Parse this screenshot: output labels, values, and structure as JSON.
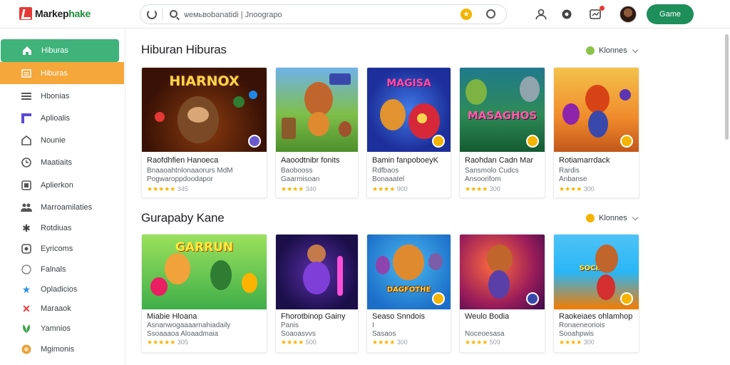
{
  "app": {
    "logo_part1": "Markep",
    "logo_part2": "hake"
  },
  "search": {
    "value": "ѡемьвоbanatidi | Jnoograpo"
  },
  "header": {
    "game_button": "Game"
  },
  "sidebar": {
    "items": [
      {
        "label": "Hiburas",
        "icon": "home-icon"
      },
      {
        "label": "Hiburas",
        "icon": "list-icon"
      },
      {
        "label": "Hbonias",
        "icon": "menu-icon"
      },
      {
        "label": "Aplioalis",
        "icon": "app-icon"
      },
      {
        "label": "Nounie",
        "icon": "house-icon"
      },
      {
        "label": "Maatiaits",
        "icon": "clock-icon"
      },
      {
        "label": "Aplierkon",
        "icon": "square-icon"
      },
      {
        "label": "Marroamilaties",
        "icon": "people-icon"
      },
      {
        "label": "Rotdiuas",
        "icon": "star-icon"
      },
      {
        "label": "Eyricoms",
        "icon": "gear-icon"
      },
      {
        "label": "Falnals",
        "icon": "circle-icon"
      },
      {
        "label": "Opladicios",
        "icon": "badge-icon"
      },
      {
        "label": "Maraaok",
        "icon": "cross-icon"
      },
      {
        "label": "Yamnios",
        "icon": "leaf-icon"
      },
      {
        "label": "Mgimonis",
        "icon": "coin-icon"
      }
    ]
  },
  "sections": [
    {
      "title": "Hiburan Hiburas",
      "sort": "Klonnes",
      "cards": [
        {
          "name": "Raofdhfien Hanoeca",
          "desc1": "Bnaaoahtnlonaaorurs MdM",
          "desc2": "Pogwaroppdoodapor",
          "rating": "★★★★★",
          "num": "345",
          "art": "HIARNOX"
        },
        {
          "name": "Aaoodtnibr fonits",
          "desc1": "Baobooss",
          "desc2": "Gaarmisoan",
          "rating": "★★★★",
          "num": "340",
          "art": ""
        },
        {
          "name": "Bamin fanpoboeyK",
          "desc1": "Rdfbaos",
          "desc2": "Bonaaatel",
          "rating": "★★★★",
          "num": "900",
          "art": "MAGISA"
        },
        {
          "name": "Raohdan Cadn Mar",
          "desc1": "Sansmolo Cudcs",
          "desc2": "Ansoorifom",
          "rating": "★★★★",
          "num": "300",
          "art": "MASAGHOS"
        },
        {
          "name": "Rotiamarrdack",
          "desc1": "Rardis",
          "desc2": "Anbanse",
          "rating": "★★★★",
          "num": "300",
          "art": ""
        }
      ]
    },
    {
      "title": "Gurapaby Kane",
      "sort": "Klonnes",
      "cards": [
        {
          "name": "Miabie Hloana",
          "desc1": "Asnanwogaaaarnahiadaily",
          "desc2": "Ssoaaaoa Aloaadmaia",
          "rating": "★★★★★",
          "num": "305",
          "art": "GARRUN"
        },
        {
          "name": "Fhorotbinop Gainy",
          "desc1": "Panis",
          "desc2": "Soaoasvvs",
          "rating": "★★★★",
          "num": "500",
          "art": ""
        },
        {
          "name": "Seaso Snndois",
          "desc1": "I",
          "desc2": "Sasaos",
          "rating": "★★★★",
          "num": "300",
          "art": "DAGFOTHE"
        },
        {
          "name": "Weulo Bodia",
          "desc1": "",
          "desc2": "Noceoesasa",
          "rating": "★★★★",
          "num": "509",
          "art": ""
        },
        {
          "name": "Raokeiaes ohlamhop",
          "desc1": "Ronaeneoriois",
          "desc2": "Sooahpwis",
          "rating": "★★★★",
          "num": "300",
          "art": "SOCIALS"
        }
      ]
    }
  ],
  "colors": {
    "accent_green": "#3fb37a",
    "accent_orange": "#f5a73a",
    "button_green": "#1e8e5a",
    "rating_gold": "#f5b400"
  }
}
